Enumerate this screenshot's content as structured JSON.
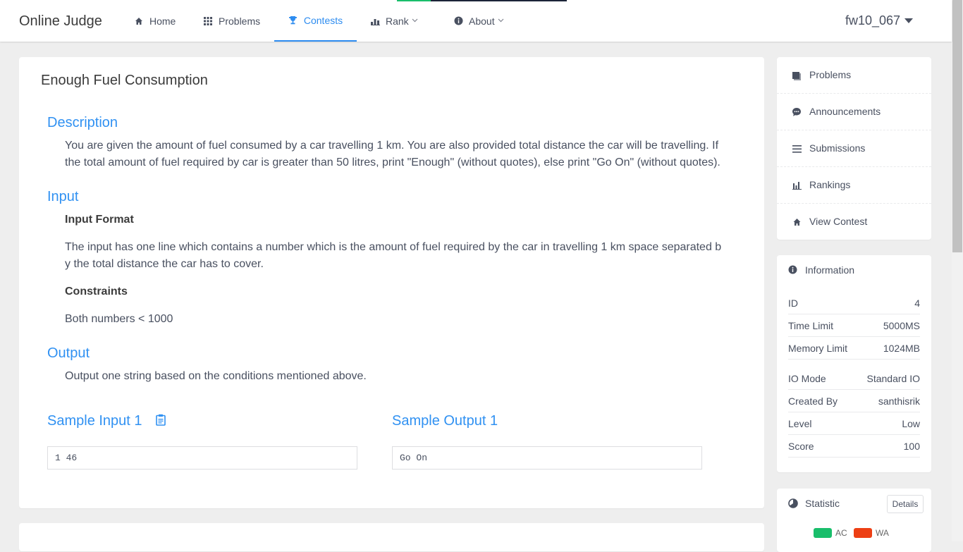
{
  "nav": {
    "brand": "Online Judge",
    "items": [
      {
        "label": "Home",
        "icon": "home-icon"
      },
      {
        "label": "Problems",
        "icon": "grid-icon"
      },
      {
        "label": "Contests",
        "icon": "trophy-icon",
        "active": true
      },
      {
        "label": "Rank",
        "icon": "bar-chart-icon",
        "dropdown": true
      },
      {
        "label": "About",
        "icon": "info-icon",
        "dropdown": true
      }
    ],
    "user": "fw10_067"
  },
  "problem": {
    "title": "Enough Fuel Consumption",
    "description_title": "Description",
    "description": "You are given the amount of fuel consumed by a car travelling 1 km. You are also provided total distance the car will be travelling. If the total amount of fuel required by car is greater than 50 litres, print \"Enough\" (without quotes), else print \"Go On\" (without quotes).",
    "input_title": "Input",
    "input_format_label": "Input Format",
    "input_format": "The input has one line which contains a number which is the amount of fuel required by the car in travelling 1 km space separated by the total distance the car has to cover.",
    "constraints_label": "Constraints",
    "constraints": "Both numbers < 1000",
    "output_title": "Output",
    "output": "Output one string based on the conditions mentioned above.",
    "sample_input_title": "Sample Input 1",
    "sample_output_title": "Sample Output 1",
    "sample_input": "1 46",
    "sample_output": "Go On"
  },
  "sidebar": {
    "menu": [
      {
        "label": "Problems",
        "icon": "book-icon"
      },
      {
        "label": "Announcements",
        "icon": "chat-icon"
      },
      {
        "label": "Submissions",
        "icon": "list-icon"
      },
      {
        "label": "Rankings",
        "icon": "bar-chart-icon"
      },
      {
        "label": "View Contest",
        "icon": "home-icon"
      }
    ],
    "info": {
      "title": "Information",
      "rows": [
        {
          "label": "ID",
          "value": "4"
        },
        {
          "label": "Time Limit",
          "value": "5000MS"
        },
        {
          "label": "Memory Limit",
          "value": "1024MB"
        },
        {
          "label": "IO Mode",
          "value": "Standard IO"
        },
        {
          "label": "Created By",
          "value": "santhisrik"
        },
        {
          "label": "Level",
          "value": "Low"
        },
        {
          "label": "Score",
          "value": "100"
        }
      ]
    },
    "statistic": {
      "title": "Statistic",
      "details": "Details",
      "legend": [
        {
          "label": "AC",
          "color": "#19be6b"
        },
        {
          "label": "WA",
          "color": "#ed3f14"
        }
      ]
    }
  },
  "colors": {
    "accent": "#2d8cf0",
    "heading": "#3091f2"
  }
}
